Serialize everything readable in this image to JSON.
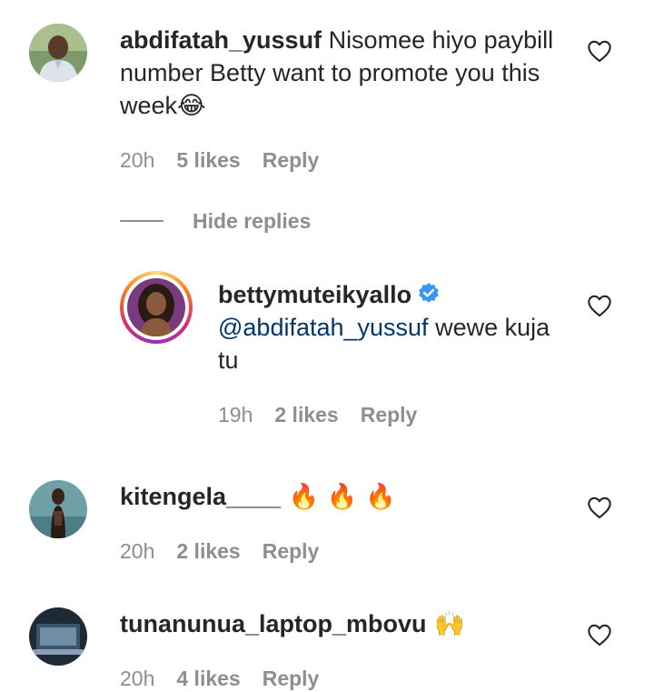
{
  "comments": [
    {
      "username": "abdifatah_yussuf",
      "text": " Nisomee hiyo paybill number Betty want to promote you this week",
      "emoji": "😂",
      "time": "20h",
      "likes": "5 likes",
      "reply": "Reply",
      "avatar_icon": "man-portrait-avatar"
    },
    {
      "username": "kitengela____",
      "text": "  🔥 🔥 🔥",
      "time": "20h",
      "likes": "2 likes",
      "reply": "Reply",
      "avatar_icon": "woman-portrait-avatar"
    },
    {
      "username": "tunanunua_laptop_mbovu",
      "text": " 🙌",
      "time": "20h",
      "likes": "4 likes",
      "reply": "Reply",
      "avatar_icon": "laptop-avatar"
    }
  ],
  "hide_replies": "Hide replies",
  "reply_comment": {
    "username": "bettymuteikyallo",
    "verified": true,
    "mention": "@abdifatah_yussuf",
    "text": " wewe kuja tu",
    "time": "19h",
    "likes": "2 likes",
    "reply": "Reply"
  },
  "colors": {
    "text": "#262626",
    "meta": "#8e8e8e",
    "mention": "#00376b",
    "verified": "#3897f0"
  }
}
